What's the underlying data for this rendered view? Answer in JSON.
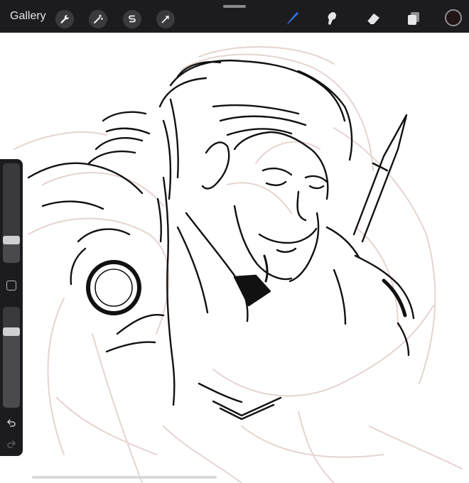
{
  "topbar": {
    "gallery_label": "Gallery",
    "left_tools": [
      "wrench-icon",
      "magic-wand-icon",
      "selection-icon",
      "transform-arrow-icon"
    ],
    "right_tools": [
      "brush-icon",
      "smudge-icon",
      "eraser-icon",
      "layers-icon"
    ],
    "active_tool": "brush-icon",
    "current_color": "#221616",
    "accent": "#2f7bf6"
  },
  "sidebar": {
    "brush_size": 0.2,
    "opacity": 0.78,
    "controls": [
      "modify-button",
      "undo-icon",
      "redo-icon"
    ]
  },
  "canvas": {
    "ink_color": "#111111",
    "sketch_color": "#e6d4d0"
  }
}
